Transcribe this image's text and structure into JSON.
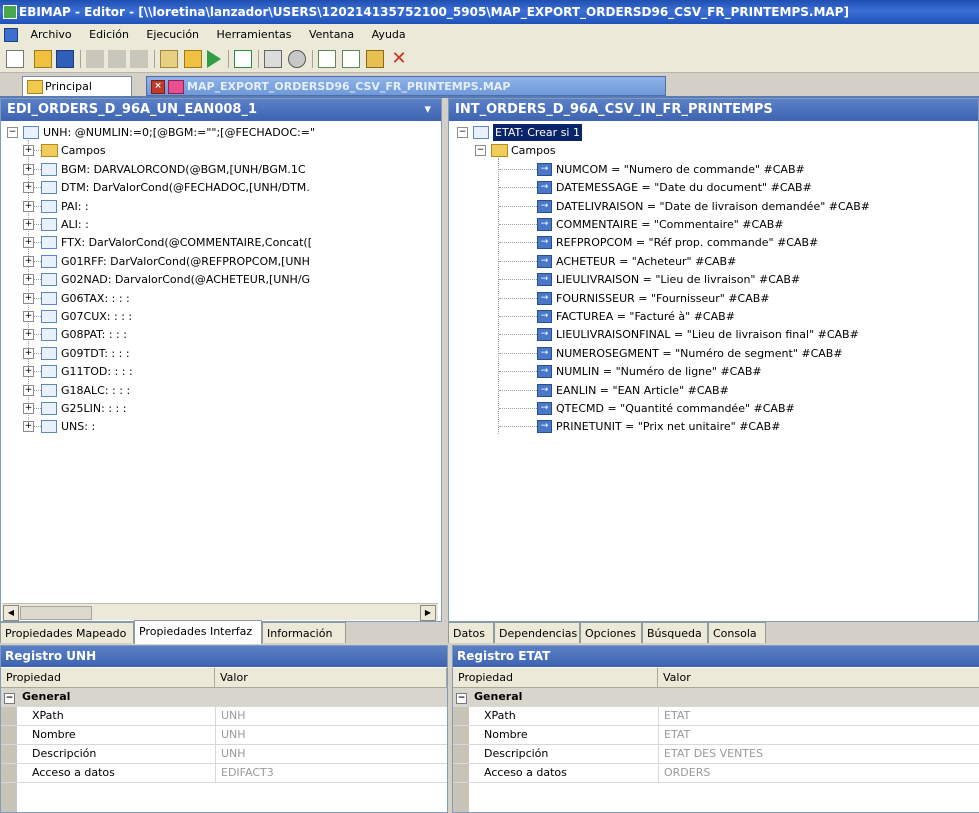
{
  "window": {
    "title": "EBIMAP - Editor - [\\\\loretina\\lanzador\\USERS\\120214135752100_5905\\MAP_EXPORT_ORDERSD96_CSV_FR_PRINTEMPS.MAP]"
  },
  "menu": [
    "Archivo",
    "Edición",
    "Ejecución",
    "Herramientas",
    "Ventana",
    "Ayuda"
  ],
  "doc_tabs": {
    "principal": "Principal",
    "map": "MAP_EXPORT_ORDERSD96_CSV_FR_PRINTEMPS.MAP"
  },
  "left_tree": {
    "header": "EDI_ORDERS_D_96A_UN_EAN008_1",
    "root": "UNH: @NUMLIN:=0;[@BGM:=\"\";[@FECHADOC:=\"",
    "items": [
      "Campos",
      "BGM: DARVALORCOND(@BGM,[UNH/BGM.1C",
      "DTM: DarValorCond(@FECHADOC,[UNH/DTM.",
      "PAI: :",
      "ALI: :",
      "FTX: DarValorCond(@COMMENTAIRE,Concat([",
      "G01RFF: DarValorCond(@REFPROPCOM,[UNH",
      "G02NAD: DarvalorCond(@ACHETEUR,[UNH/G",
      "G06TAX: : : :",
      "G07CUX: : : :",
      "G08PAT: : : :",
      "G09TDT: : : :",
      "G11TOD: : : :",
      "G18ALC: : : :",
      "G25LIN: : : :",
      "UNS: :"
    ]
  },
  "right_tree": {
    "header": "INT_ORDERS_D_96A_CSV_IN_FR_PRINTEMPS",
    "root": "ETAT: Crear si 1",
    "folder": "Campos",
    "fields": [
      "NUMCOM = \"Numero de commande\" #CAB#",
      "DATEMESSAGE = \"Date du document\" #CAB#",
      "DATELIVRAISON = \"Date de livraison demandée\" #CAB#",
      "COMMENTAIRE = \"Commentaire\" #CAB#",
      "REFPROPCOM = \"Réf prop. commande\" #CAB#",
      "ACHETEUR = \"Acheteur\" #CAB#",
      "LIEULIVRAISON = \"Lieu de livraison\" #CAB#",
      "FOURNISSEUR = \"Fournisseur\" #CAB#",
      "FACTUREA = \"Facturé à\" #CAB#",
      "LIEULIVRAISONFINAL = \"Lieu de livraison final\" #CAB#",
      "NUMEROSEGMENT = \"Numéro de segment\" #CAB#",
      "NUMLIN = \"Numéro de ligne\" #CAB#",
      "EANLIN = \"EAN Article\" #CAB#",
      "QTECMD = \"Quantité commandée\" #CAB#",
      "PRINETUNIT = \"Prix net unitaire\" #CAB#"
    ]
  },
  "bottom_tabs_left": [
    "Propiedades Mapeado",
    "Propiedades Interfaz",
    "Información"
  ],
  "bottom_tabs_right": [
    "Datos",
    "Dependencias",
    "Opciones",
    "Búsqueda",
    "Consola"
  ],
  "grid_left": {
    "title": "Registro UNH",
    "col_prop": "Propiedad",
    "col_val": "Valor",
    "section": "General",
    "rows": [
      {
        "k": "XPath",
        "v": "UNH"
      },
      {
        "k": "Nombre",
        "v": "UNH"
      },
      {
        "k": "Descripción",
        "v": "UNH"
      },
      {
        "k": "Acceso a datos",
        "v": "EDIFACT3"
      }
    ]
  },
  "grid_right": {
    "title": "Registro ETAT",
    "col_prop": "Propiedad",
    "col_val": "Valor",
    "section": "General",
    "rows": [
      {
        "k": "XPath",
        "v": "ETAT"
      },
      {
        "k": "Nombre",
        "v": "ETAT"
      },
      {
        "k": "Descripción",
        "v": "ETAT DES VENTES"
      },
      {
        "k": "Acceso a datos",
        "v": "ORDERS"
      }
    ]
  }
}
